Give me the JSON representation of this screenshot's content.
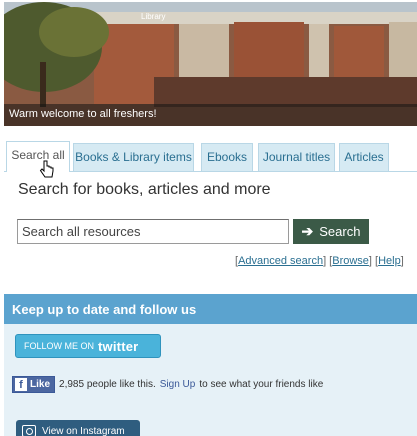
{
  "banner": {
    "caption": "Warm welcome to all freshers!",
    "building_sign": "Library"
  },
  "tabs": [
    {
      "label": "Search all",
      "active": true
    },
    {
      "label": "Books & Library items",
      "active": false
    },
    {
      "label": "Ebooks",
      "active": false
    },
    {
      "label": "Journal titles",
      "active": false
    },
    {
      "label": "Articles",
      "active": false
    }
  ],
  "search": {
    "heading": "Search for books, articles and more",
    "placeholder": "Search all resources",
    "button_label": "Search",
    "button_icon": "arrow-right-icon",
    "advanced_label": "Advanced search",
    "browse_label": "Browse",
    "help_label": "Help"
  },
  "follow": {
    "heading": "Keep up to date and follow us",
    "twitter_prefix": "FOLLOW ME ON",
    "twitter_word": "twitter",
    "fb_like_label": "Like",
    "fb_count_text": "2,985 people like this.",
    "fb_signup_label": "Sign Up",
    "fb_suffix_text": "to see what your friends like",
    "instagram_label": "View on Instagram"
  },
  "colors": {
    "tab_bg": "#d6eaf3",
    "search_button": "#3b5a47",
    "follow_header": "#5ba3cf",
    "twitter": "#4ab3da",
    "facebook": "#4c67a1"
  }
}
